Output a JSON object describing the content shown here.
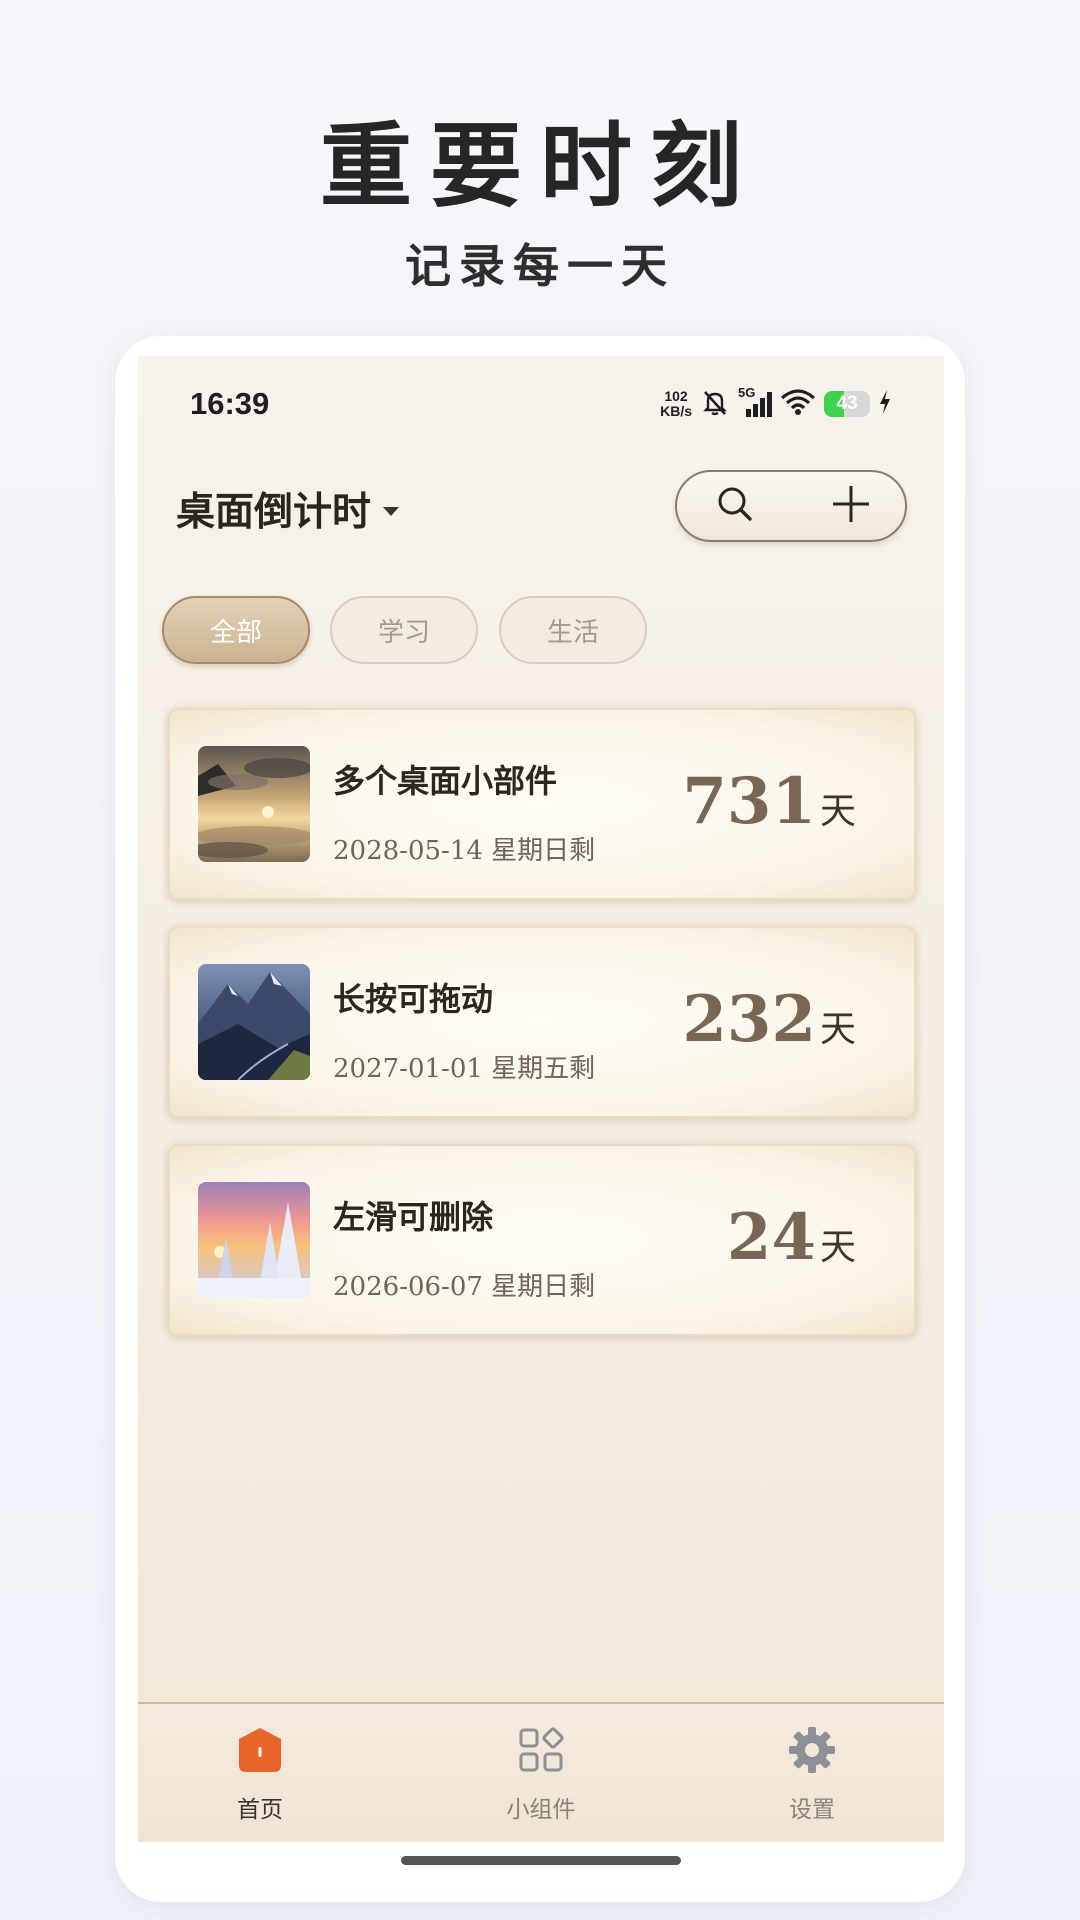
{
  "promo": {
    "title": "重要时刻",
    "subtitle": "记录每一天"
  },
  "status_bar": {
    "time": "16:39",
    "net_speed_value": "102",
    "net_speed_unit": "KB/s",
    "network_type": "5G",
    "battery_level": "43",
    "battery_percent": 43,
    "battery_color": "#3fd24b",
    "icons": [
      "mute-bell-icon",
      "signal-icon",
      "wifi-icon",
      "battery-icon",
      "charging-bolt-icon"
    ]
  },
  "header": {
    "title": "桌面倒计时",
    "dropdown_icon": "caret-down-icon",
    "search_icon": "search-icon",
    "add_icon": "plus-icon"
  },
  "tabs": [
    {
      "label": "全部",
      "active": true
    },
    {
      "label": "学习",
      "active": false
    },
    {
      "label": "生活",
      "active": false
    }
  ],
  "events": [
    {
      "title": "多个桌面小部件",
      "date": "2028-05-14 星期日剩",
      "days": "731",
      "unit": "天",
      "thumbnail": "sunset-clouds-landscape"
    },
    {
      "title": "长按可拖动",
      "date": "2027-01-01 星期五剩",
      "days": "232",
      "unit": "天",
      "thumbnail": "mountain-valley-landscape"
    },
    {
      "title": "左滑可删除",
      "date": "2026-06-07 星期日剩",
      "days": "24",
      "unit": "天",
      "thumbnail": "snowy-forest-sunset"
    }
  ],
  "bottom_nav": [
    {
      "label": "首页",
      "icon": "home-icon",
      "active": true,
      "color": "#e8632a"
    },
    {
      "label": "小组件",
      "icon": "widgets-icon",
      "active": false,
      "color": "#8d8f96"
    },
    {
      "label": "设置",
      "icon": "gear-icon",
      "active": false,
      "color": "#8d8f96"
    }
  ],
  "colors": {
    "accent": "#e8632a",
    "tab_active": "#cbb290",
    "count_number": "#7a6655"
  }
}
